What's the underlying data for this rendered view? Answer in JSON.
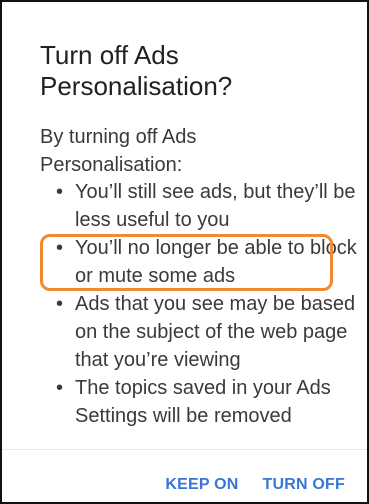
{
  "dialog": {
    "title": "Turn off Ads Personalisation?",
    "intro": "By turning off Ads Personalisation:",
    "bullets": [
      "You’ll still see ads, but they’ll be less useful to you",
      "You’ll no longer be able to block or mute some ads",
      "Ads that you see may be based on the subject of the web page that you’re viewing",
      "The topics saved in your Ads Settings will be removed"
    ],
    "bullet_symbol": "•",
    "actions": {
      "keep_on": "KEEP ON",
      "turn_off": "TURN OFF"
    }
  },
  "colors": {
    "accent": "#3a75d6",
    "highlight": "#ef8a2e",
    "text": "#3a3a3a"
  }
}
